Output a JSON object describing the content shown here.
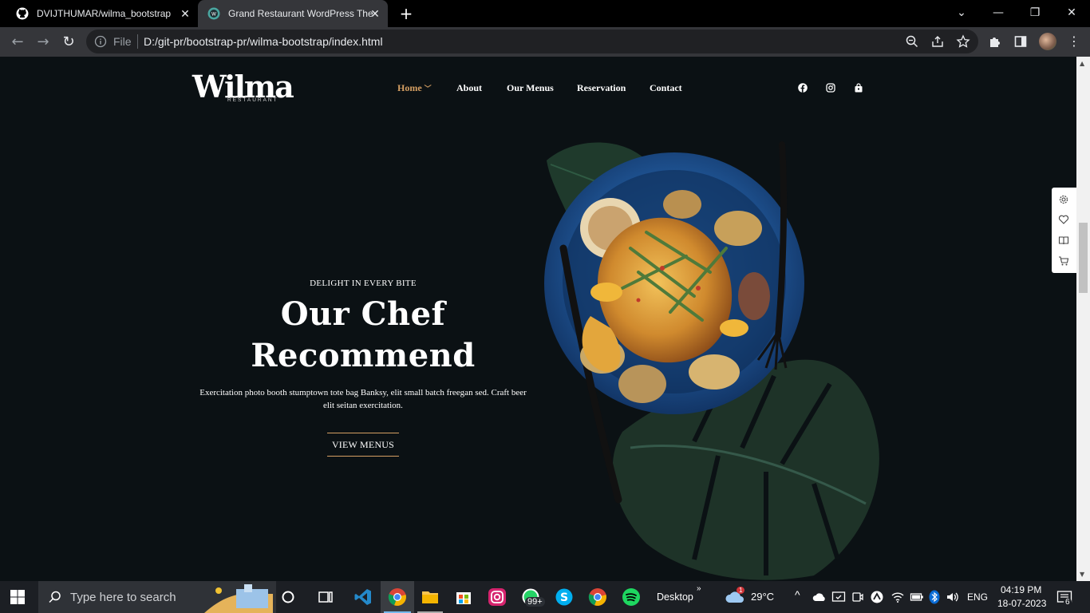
{
  "browser": {
    "tabs": [
      {
        "title": "DVIJTHUMAR/wilma_bootstrap",
        "icon": "github-icon",
        "active": false
      },
      {
        "title": "Grand Restaurant WordPress The",
        "icon": "site-favicon",
        "active": true
      }
    ],
    "address": {
      "scheme_label": "File",
      "url": "D:/git-pr/bootstrap-pr/wilma-bootstrap/index.html"
    },
    "accent": "#35363a"
  },
  "site": {
    "logo": {
      "word": "Wilma",
      "tagline": "RESTAURANT"
    },
    "nav": {
      "home": "Home",
      "about": "About",
      "menus": "Our Menus",
      "reservation": "Reservation",
      "contact": "Contact"
    },
    "social": [
      "facebook-icon",
      "instagram-icon",
      "cart-bag-icon"
    ],
    "hero": {
      "eyebrow": "DELIGHT IN EVERY BITE",
      "line1": "Our Chef",
      "line2": "Recommend",
      "description": "Exercitation photo booth stumptown tote bag Banksy, elit small batch freegan sed. Craft beer elit seitan exercitation.",
      "cta": "VIEW MENUS"
    },
    "colors": {
      "background": "#0b1114",
      "accent": "#d59f63",
      "plate": "#1d4f8c"
    },
    "side_tools": [
      "settings-icon",
      "heart-icon",
      "book-icon",
      "cart-icon"
    ]
  },
  "taskbar": {
    "search_placeholder": "Type here to search",
    "whatsapp_badge": "99+",
    "desktop_label": "Desktop",
    "weather": "29°C",
    "weather_badge": "1",
    "language": "ENG",
    "time": "04:19 PM",
    "date": "18-07-2023",
    "notifications": "6"
  }
}
